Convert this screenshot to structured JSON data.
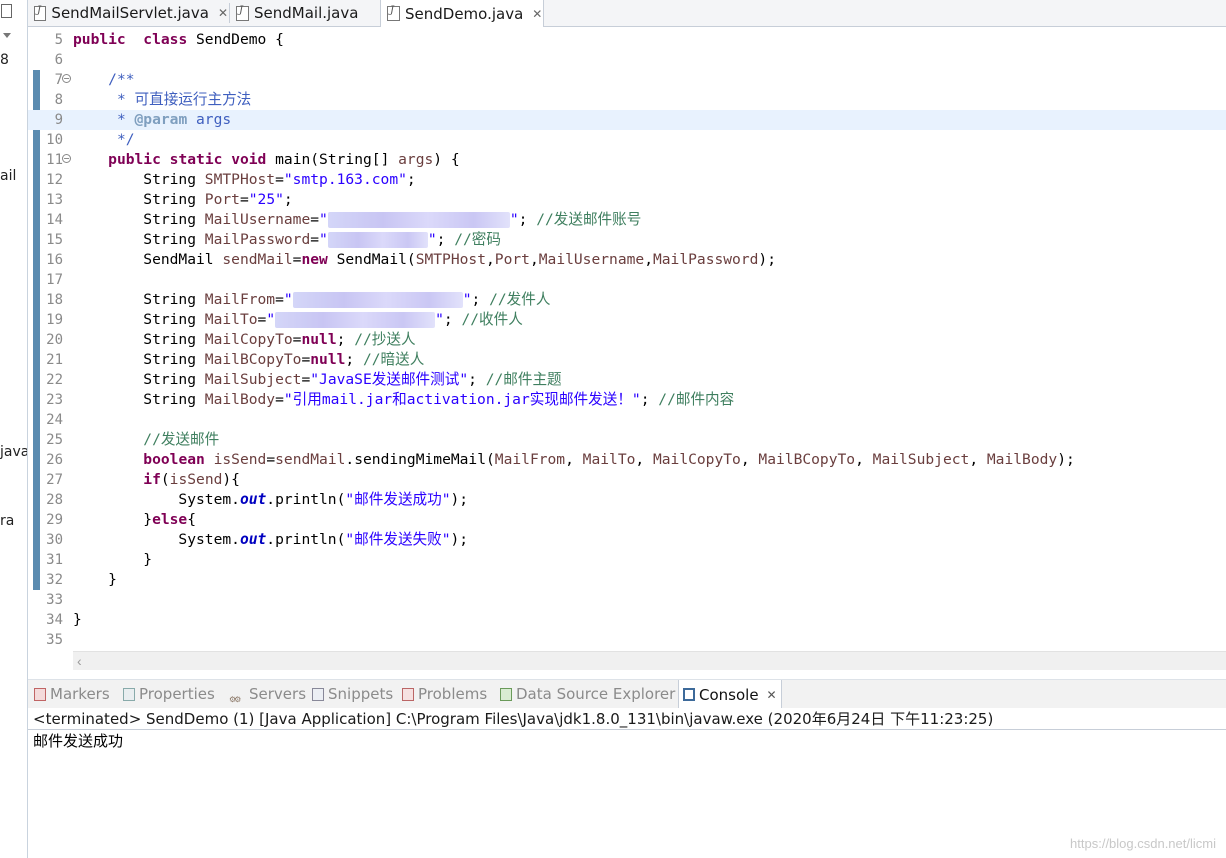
{
  "left_panel": {
    "fragments": [
      "8",
      "ail",
      "java",
      "ra"
    ]
  },
  "editor_tabs": [
    {
      "label": "SendMailServlet.java",
      "active": false,
      "close": "✕"
    },
    {
      "label": "SendMail.java",
      "active": false
    },
    {
      "label": "SendDemo.java",
      "active": true,
      "close": "✕"
    }
  ],
  "editor": {
    "highlighted_line": 9,
    "lines": [
      {
        "n": "5",
        "t": [
          [
            "kw",
            "public"
          ],
          [
            "",
            "  "
          ],
          [
            "kw",
            "class"
          ],
          [
            "",
            " SendDemo {"
          ]
        ]
      },
      {
        "n": "6",
        "t": []
      },
      {
        "n": "7",
        "fold": true,
        "t": [
          [
            "",
            "    "
          ],
          [
            "jd",
            "/**"
          ]
        ]
      },
      {
        "n": "8",
        "t": [
          [
            "",
            "     "
          ],
          [
            "jd",
            "* 可直接运行主方法"
          ]
        ]
      },
      {
        "n": "9",
        "t": [
          [
            "",
            "     "
          ],
          [
            "jd",
            "* "
          ],
          [
            "jtag",
            "@param"
          ],
          [
            "jd",
            " args"
          ]
        ]
      },
      {
        "n": "10",
        "t": [
          [
            "",
            "     "
          ],
          [
            "jd",
            "*/"
          ]
        ]
      },
      {
        "n": "11",
        "fold": true,
        "t": [
          [
            "",
            "    "
          ],
          [
            "kw",
            "public"
          ],
          [
            "",
            " "
          ],
          [
            "kw",
            "static"
          ],
          [
            "",
            " "
          ],
          [
            "kw",
            "void"
          ],
          [
            "",
            " main(String[] "
          ],
          [
            "var",
            "args"
          ],
          [
            "",
            ") {"
          ]
        ]
      },
      {
        "n": "12",
        "t": [
          [
            "",
            "        String "
          ],
          [
            "var",
            "SMTPHost"
          ],
          [
            "",
            "="
          ],
          [
            "str",
            "\"smtp.163.com\""
          ],
          [
            "",
            ";"
          ]
        ]
      },
      {
        "n": "13",
        "t": [
          [
            "",
            "        String "
          ],
          [
            "var",
            "Port"
          ],
          [
            "",
            "="
          ],
          [
            "str",
            "\"25\""
          ],
          [
            "",
            ";"
          ]
        ]
      },
      {
        "n": "14",
        "t": [
          [
            "",
            "        String "
          ],
          [
            "var",
            "MailUsername"
          ],
          [
            "",
            "="
          ],
          [
            "str",
            "\""
          ],
          [
            "blur",
            "182"
          ],
          [
            "str",
            "\""
          ],
          [
            "",
            "; "
          ],
          [
            "cmt",
            "//发送邮件账号"
          ]
        ]
      },
      {
        "n": "15",
        "t": [
          [
            "",
            "        String "
          ],
          [
            "var",
            "MailPassword"
          ],
          [
            "",
            "="
          ],
          [
            "str",
            "\""
          ],
          [
            "blur",
            "100"
          ],
          [
            "str",
            "\""
          ],
          [
            "",
            "; "
          ],
          [
            "cmt",
            "//密码"
          ]
        ]
      },
      {
        "n": "16",
        "t": [
          [
            "",
            "        SendMail "
          ],
          [
            "var",
            "sendMail"
          ],
          [
            "",
            "="
          ],
          [
            "kw",
            "new"
          ],
          [
            "",
            " SendMail("
          ],
          [
            "var",
            "SMTPHost"
          ],
          [
            "",
            ","
          ],
          [
            "var",
            "Port"
          ],
          [
            "",
            ","
          ],
          [
            "var",
            "MailUsername"
          ],
          [
            "",
            ","
          ],
          [
            "var",
            "MailPassword"
          ],
          [
            "",
            ");"
          ]
        ]
      },
      {
        "n": "17",
        "t": []
      },
      {
        "n": "18",
        "t": [
          [
            "",
            "        String "
          ],
          [
            "var",
            "MailFrom"
          ],
          [
            "",
            "="
          ],
          [
            "str",
            "\""
          ],
          [
            "blur",
            "170"
          ],
          [
            "str",
            "\""
          ],
          [
            "",
            "; "
          ],
          [
            "cmt",
            "//发件人"
          ]
        ]
      },
      {
        "n": "19",
        "t": [
          [
            "",
            "        String "
          ],
          [
            "var",
            "MailTo"
          ],
          [
            "",
            "="
          ],
          [
            "str",
            "\""
          ],
          [
            "blur",
            "160"
          ],
          [
            "str",
            "\""
          ],
          [
            "",
            "; "
          ],
          [
            "cmt",
            "//收件人"
          ]
        ]
      },
      {
        "n": "20",
        "t": [
          [
            "",
            "        String "
          ],
          [
            "var",
            "MailCopyTo"
          ],
          [
            "",
            "="
          ],
          [
            "kw",
            "null"
          ],
          [
            "",
            "; "
          ],
          [
            "cmt",
            "//抄送人"
          ]
        ]
      },
      {
        "n": "21",
        "t": [
          [
            "",
            "        String "
          ],
          [
            "var",
            "MailBCopyTo"
          ],
          [
            "",
            "="
          ],
          [
            "kw",
            "null"
          ],
          [
            "",
            "; "
          ],
          [
            "cmt",
            "//暗送人"
          ]
        ]
      },
      {
        "n": "22",
        "t": [
          [
            "",
            "        String "
          ],
          [
            "var",
            "MailSubject"
          ],
          [
            "",
            "="
          ],
          [
            "str",
            "\"JavaSE发送邮件测试\""
          ],
          [
            "",
            "; "
          ],
          [
            "cmt",
            "//邮件主题"
          ]
        ]
      },
      {
        "n": "23",
        "t": [
          [
            "",
            "        String "
          ],
          [
            "var",
            "MailBody"
          ],
          [
            "",
            "="
          ],
          [
            "str",
            "\"引用mail.jar和activation.jar实现邮件发送！\""
          ],
          [
            "",
            "; "
          ],
          [
            "cmt",
            "//邮件内容"
          ]
        ]
      },
      {
        "n": "24",
        "t": []
      },
      {
        "n": "25",
        "t": [
          [
            "",
            "        "
          ],
          [
            "cmt",
            "//发送邮件"
          ]
        ]
      },
      {
        "n": "26",
        "t": [
          [
            "",
            "        "
          ],
          [
            "kw",
            "boolean"
          ],
          [
            "",
            " "
          ],
          [
            "var",
            "isSend"
          ],
          [
            "",
            "="
          ],
          [
            "var",
            "sendMail"
          ],
          [
            "",
            ".sendingMimeMail("
          ],
          [
            "var",
            "MailFrom"
          ],
          [
            "",
            ", "
          ],
          [
            "var",
            "MailTo"
          ],
          [
            "",
            ", "
          ],
          [
            "var",
            "MailCopyTo"
          ],
          [
            "",
            ", "
          ],
          [
            "var",
            "MailBCopyTo"
          ],
          [
            "",
            ", "
          ],
          [
            "var",
            "MailSubject"
          ],
          [
            "",
            ", "
          ],
          [
            "var",
            "MailBody"
          ],
          [
            "",
            ");"
          ]
        ]
      },
      {
        "n": "27",
        "t": [
          [
            "",
            "        "
          ],
          [
            "kw",
            "if"
          ],
          [
            "",
            "("
          ],
          [
            "var",
            "isSend"
          ],
          [
            "",
            "){"
          ]
        ]
      },
      {
        "n": "28",
        "t": [
          [
            "",
            "            System."
          ],
          [
            "fld",
            "out"
          ],
          [
            "",
            ".println("
          ],
          [
            "str",
            "\"邮件发送成功\""
          ],
          [
            "",
            ");"
          ]
        ]
      },
      {
        "n": "29",
        "t": [
          [
            "",
            "        }"
          ],
          [
            "kw",
            "else"
          ],
          [
            "",
            "{"
          ]
        ]
      },
      {
        "n": "30",
        "t": [
          [
            "",
            "            System."
          ],
          [
            "fld",
            "out"
          ],
          [
            "",
            ".println("
          ],
          [
            "str",
            "\"邮件发送失败\""
          ],
          [
            "",
            ");"
          ]
        ]
      },
      {
        "n": "31",
        "t": [
          [
            "",
            "        }"
          ]
        ]
      },
      {
        "n": "32",
        "t": [
          [
            "",
            "    }"
          ]
        ]
      },
      {
        "n": "33",
        "t": []
      },
      {
        "n": "34",
        "t": [
          [
            "",
            "}"
          ]
        ]
      },
      {
        "n": "35",
        "t": []
      }
    ]
  },
  "view_tabs": [
    {
      "label": "Markers",
      "icon": "markers-icon",
      "active": false
    },
    {
      "label": "Properties",
      "icon": "properties-icon",
      "active": false
    },
    {
      "label": "Servers",
      "icon": "servers-icon",
      "active": false
    },
    {
      "label": "Snippets",
      "icon": "snippets-icon",
      "active": false
    },
    {
      "label": "Problems",
      "icon": "problems-icon",
      "active": false
    },
    {
      "label": "Data Source Explorer",
      "icon": "data-source-explorer-icon",
      "active": false
    },
    {
      "label": "Console",
      "icon": "console-icon",
      "active": true,
      "close": "✕"
    }
  ],
  "console": {
    "status": "<terminated> SendDemo (1) [Java Application] C:\\Program Files\\Java\\jdk1.8.0_131\\bin\\javaw.exe (2020年6月24日 下午11:23:25)",
    "output": "邮件发送成功"
  },
  "watermark": "https://blog.csdn.net/licmi",
  "colors": {
    "keyword": "#7f0055",
    "string": "#2a00ff",
    "comment": "#3f7f5f",
    "javadoc": "#3f5fbf",
    "variable": "#6a3e3e",
    "change_bar": "#5a8bb0"
  }
}
